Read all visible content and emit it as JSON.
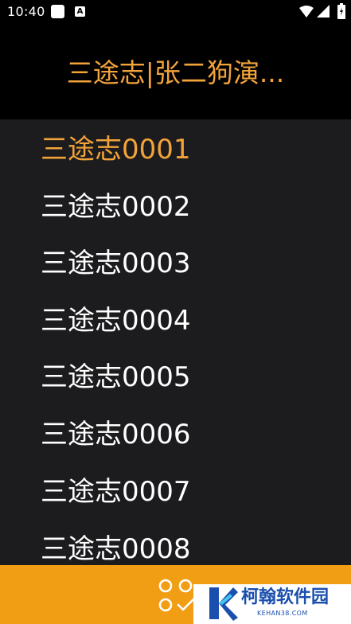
{
  "status_bar": {
    "time": "10:40",
    "notification_a": "A",
    "icons": [
      "notification-square-icon",
      "notification-a-icon",
      "wifi-icon",
      "signal-icon",
      "battery-icon"
    ]
  },
  "header": {
    "title": "三途志|张二狗演..."
  },
  "list": {
    "items": [
      {
        "label": "三途志0001",
        "active": true
      },
      {
        "label": "三途志0002",
        "active": false
      },
      {
        "label": "三途志0003",
        "active": false
      },
      {
        "label": "三途志0004",
        "active": false
      },
      {
        "label": "三途志0005",
        "active": false
      },
      {
        "label": "三途志0006",
        "active": false
      },
      {
        "label": "三途志0007",
        "active": false
      },
      {
        "label": "三途志0008",
        "active": false
      }
    ]
  },
  "bottom_bar": {
    "icon": "grid-check-icon"
  },
  "watermark": {
    "name": "柯翰软件园",
    "url": "KEHAN38.COM"
  },
  "colors": {
    "accent": "#f2a33a",
    "bottom_bar": "#f29e15",
    "list_background": "#1c1c1e",
    "header_background": "#000000",
    "item_text": "#ffffff",
    "watermark_blue": "#1b4fae"
  }
}
